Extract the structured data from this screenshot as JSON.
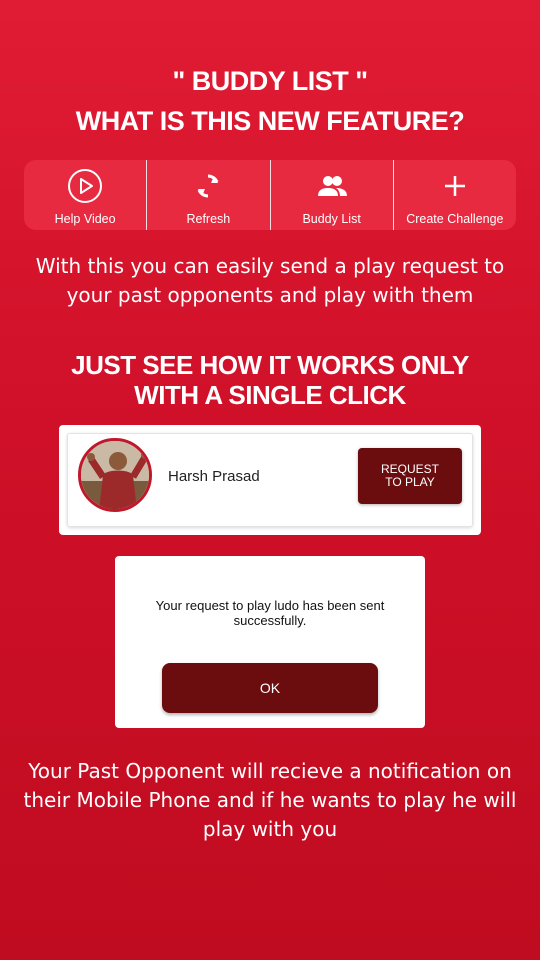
{
  "header": {
    "title_line1": "\" BUDDY LIST \"",
    "title_line2": "WHAT IS THIS NEW FEATURE?"
  },
  "toolbar": {
    "items": [
      {
        "label": "Help Video",
        "icon": "play-circle-icon"
      },
      {
        "label": "Refresh",
        "icon": "refresh-icon"
      },
      {
        "label": "Buddy List",
        "icon": "group-icon"
      },
      {
        "label": "Create Challenge",
        "icon": "plus-icon"
      }
    ]
  },
  "intro_text": "With this you can easily send a play request to your past opponents and play with them",
  "section": {
    "title_line1": "JUST SEE HOW IT WORKS ONLY",
    "title_line2": "WITH A SINGLE CLICK"
  },
  "buddy_card": {
    "name": "Harsh Prasad",
    "button_line1": "REQUEST",
    "button_line2": "TO PLAY"
  },
  "dialog": {
    "message": "Your request to play ludo has been sent successfully.",
    "ok_label": "OK"
  },
  "footer_text": "Your Past Opponent will recieve a notification on their Mobile Phone and if he wants to play he will play with you",
  "colors": {
    "background": "#d41429",
    "toolbar": "#e82a40",
    "button": "#6b0d0f"
  }
}
